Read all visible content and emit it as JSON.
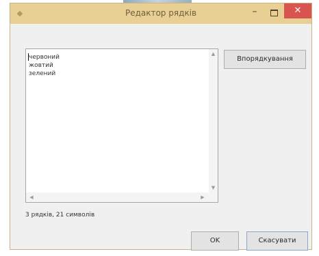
{
  "window": {
    "title": "Редактор рядків",
    "minimize_glyph": "–",
    "close_glyph": "✕"
  },
  "list": {
    "items": [
      "червоний",
      "жовтий",
      "зелений"
    ]
  },
  "buttons": {
    "sort_label": "Впорядкування",
    "ok_label": "OK",
    "cancel_label": "Скасувати"
  },
  "status": {
    "text": "3 рядків, 21 символів"
  },
  "icons": {
    "app": "app-icon",
    "minimize": "minimize-icon",
    "maximize": "maximize-icon",
    "close": "close-icon",
    "scroll_up": "scroll-up-icon",
    "scroll_down": "scroll-down-icon",
    "scroll_left": "scroll-left-icon",
    "scroll_right": "scroll-right-icon"
  },
  "colors": {
    "titlebar": "#e8cf93",
    "close_button": "#d9534f",
    "window_bg": "#f0f0f0"
  }
}
